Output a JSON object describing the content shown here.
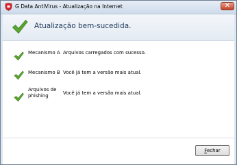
{
  "window": {
    "title": "G Data AntiVirus - Atualização na Internet",
    "close_glyph": "✕"
  },
  "header": {
    "title": "Atualização bem-sucedida.",
    "icon": "checkmark-icon"
  },
  "results": [
    {
      "name": "Mecanismo A",
      "status": "Arquivos carregados com sucesso.",
      "icon": "checkmark-icon"
    },
    {
      "name": "Mecanismo B",
      "status": "Você já tem a versão mais atual.",
      "icon": "checkmark-icon"
    },
    {
      "name": "Arquivos de phishing",
      "status": "Você já tem a versão mais atual.",
      "icon": "checkmark-icon"
    }
  ],
  "footer": {
    "close_label_first": "F",
    "close_label_rest": "echar"
  },
  "colors": {
    "check_green": "#5aa532",
    "title_blue": "#1e395b"
  }
}
